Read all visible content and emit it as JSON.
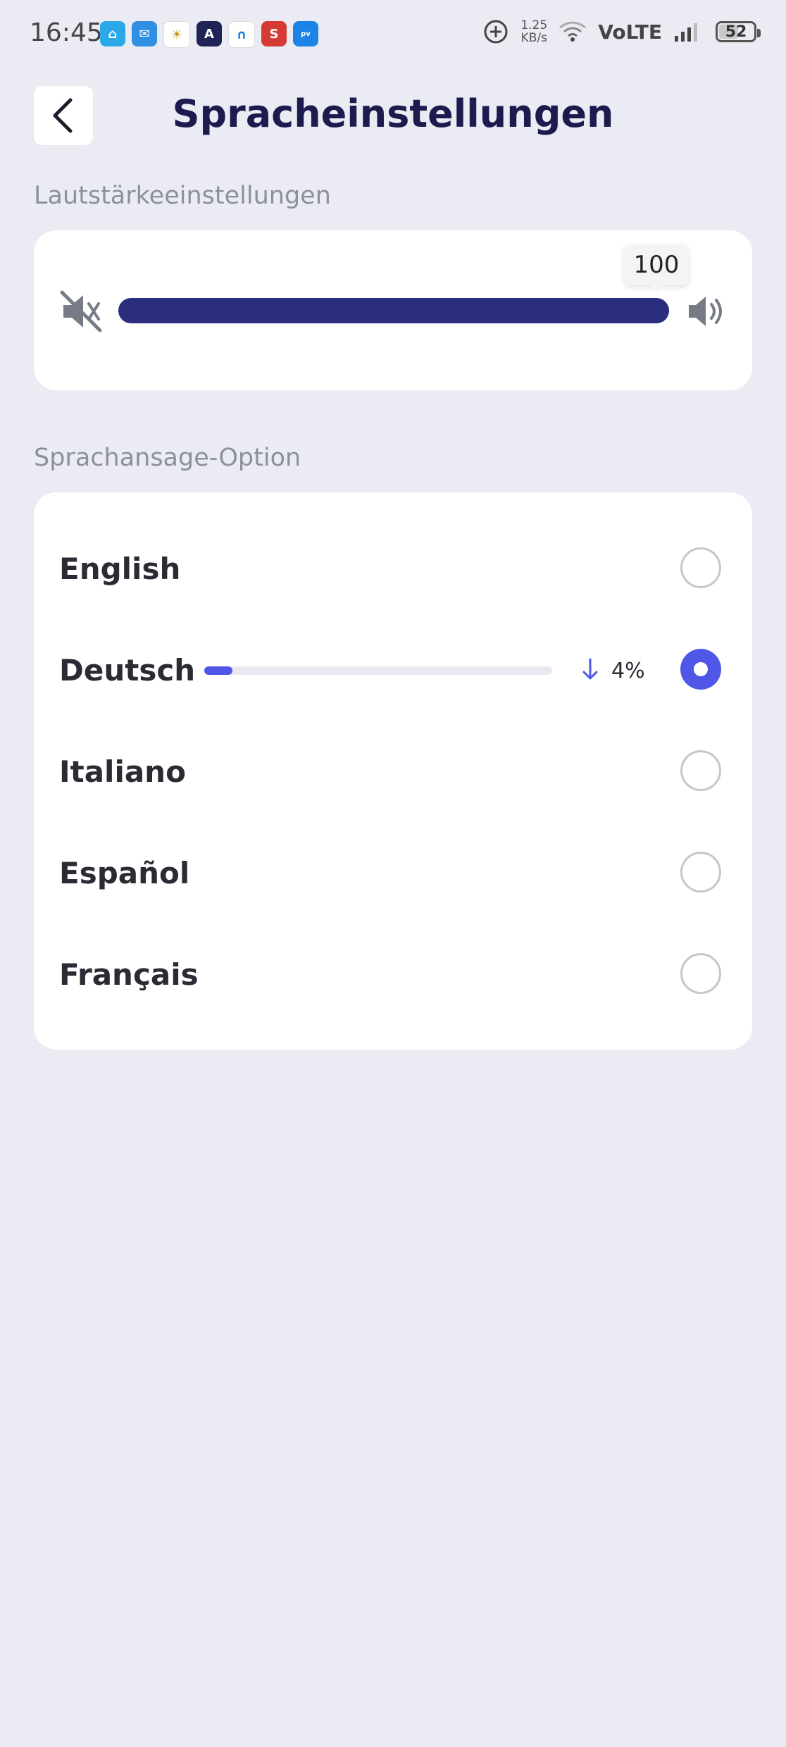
{
  "status_bar": {
    "time": "16:45",
    "network_speed_value": "1.25",
    "network_speed_unit": "KB/s",
    "network_type": "VoLTE",
    "battery": "52",
    "app_icons": [
      "home-app",
      "mail-app",
      "sun-app",
      "a-app",
      "home2-app",
      "s-app",
      "prime-video-app"
    ]
  },
  "header": {
    "title": "Spracheinstellungen",
    "back_icon": "chevron-left-icon"
  },
  "volume": {
    "section_label": "Lautstärkeeinstellungen",
    "value": "100",
    "level_percent": 100,
    "min_icon": "mute-icon",
    "max_icon": "speaker-icon",
    "track_color": "#2b2d7e"
  },
  "languages": {
    "section_label": "Sprachansage-Option",
    "items": [
      {
        "label": "English",
        "selected": false
      },
      {
        "label": "Deutsch",
        "selected": true,
        "download_percent": "4%",
        "download_progress": 0.04
      },
      {
        "label": "Italiano",
        "selected": false
      },
      {
        "label": "Español",
        "selected": false
      },
      {
        "label": "Français",
        "selected": false
      }
    ],
    "accent_color": "#5056e6"
  }
}
